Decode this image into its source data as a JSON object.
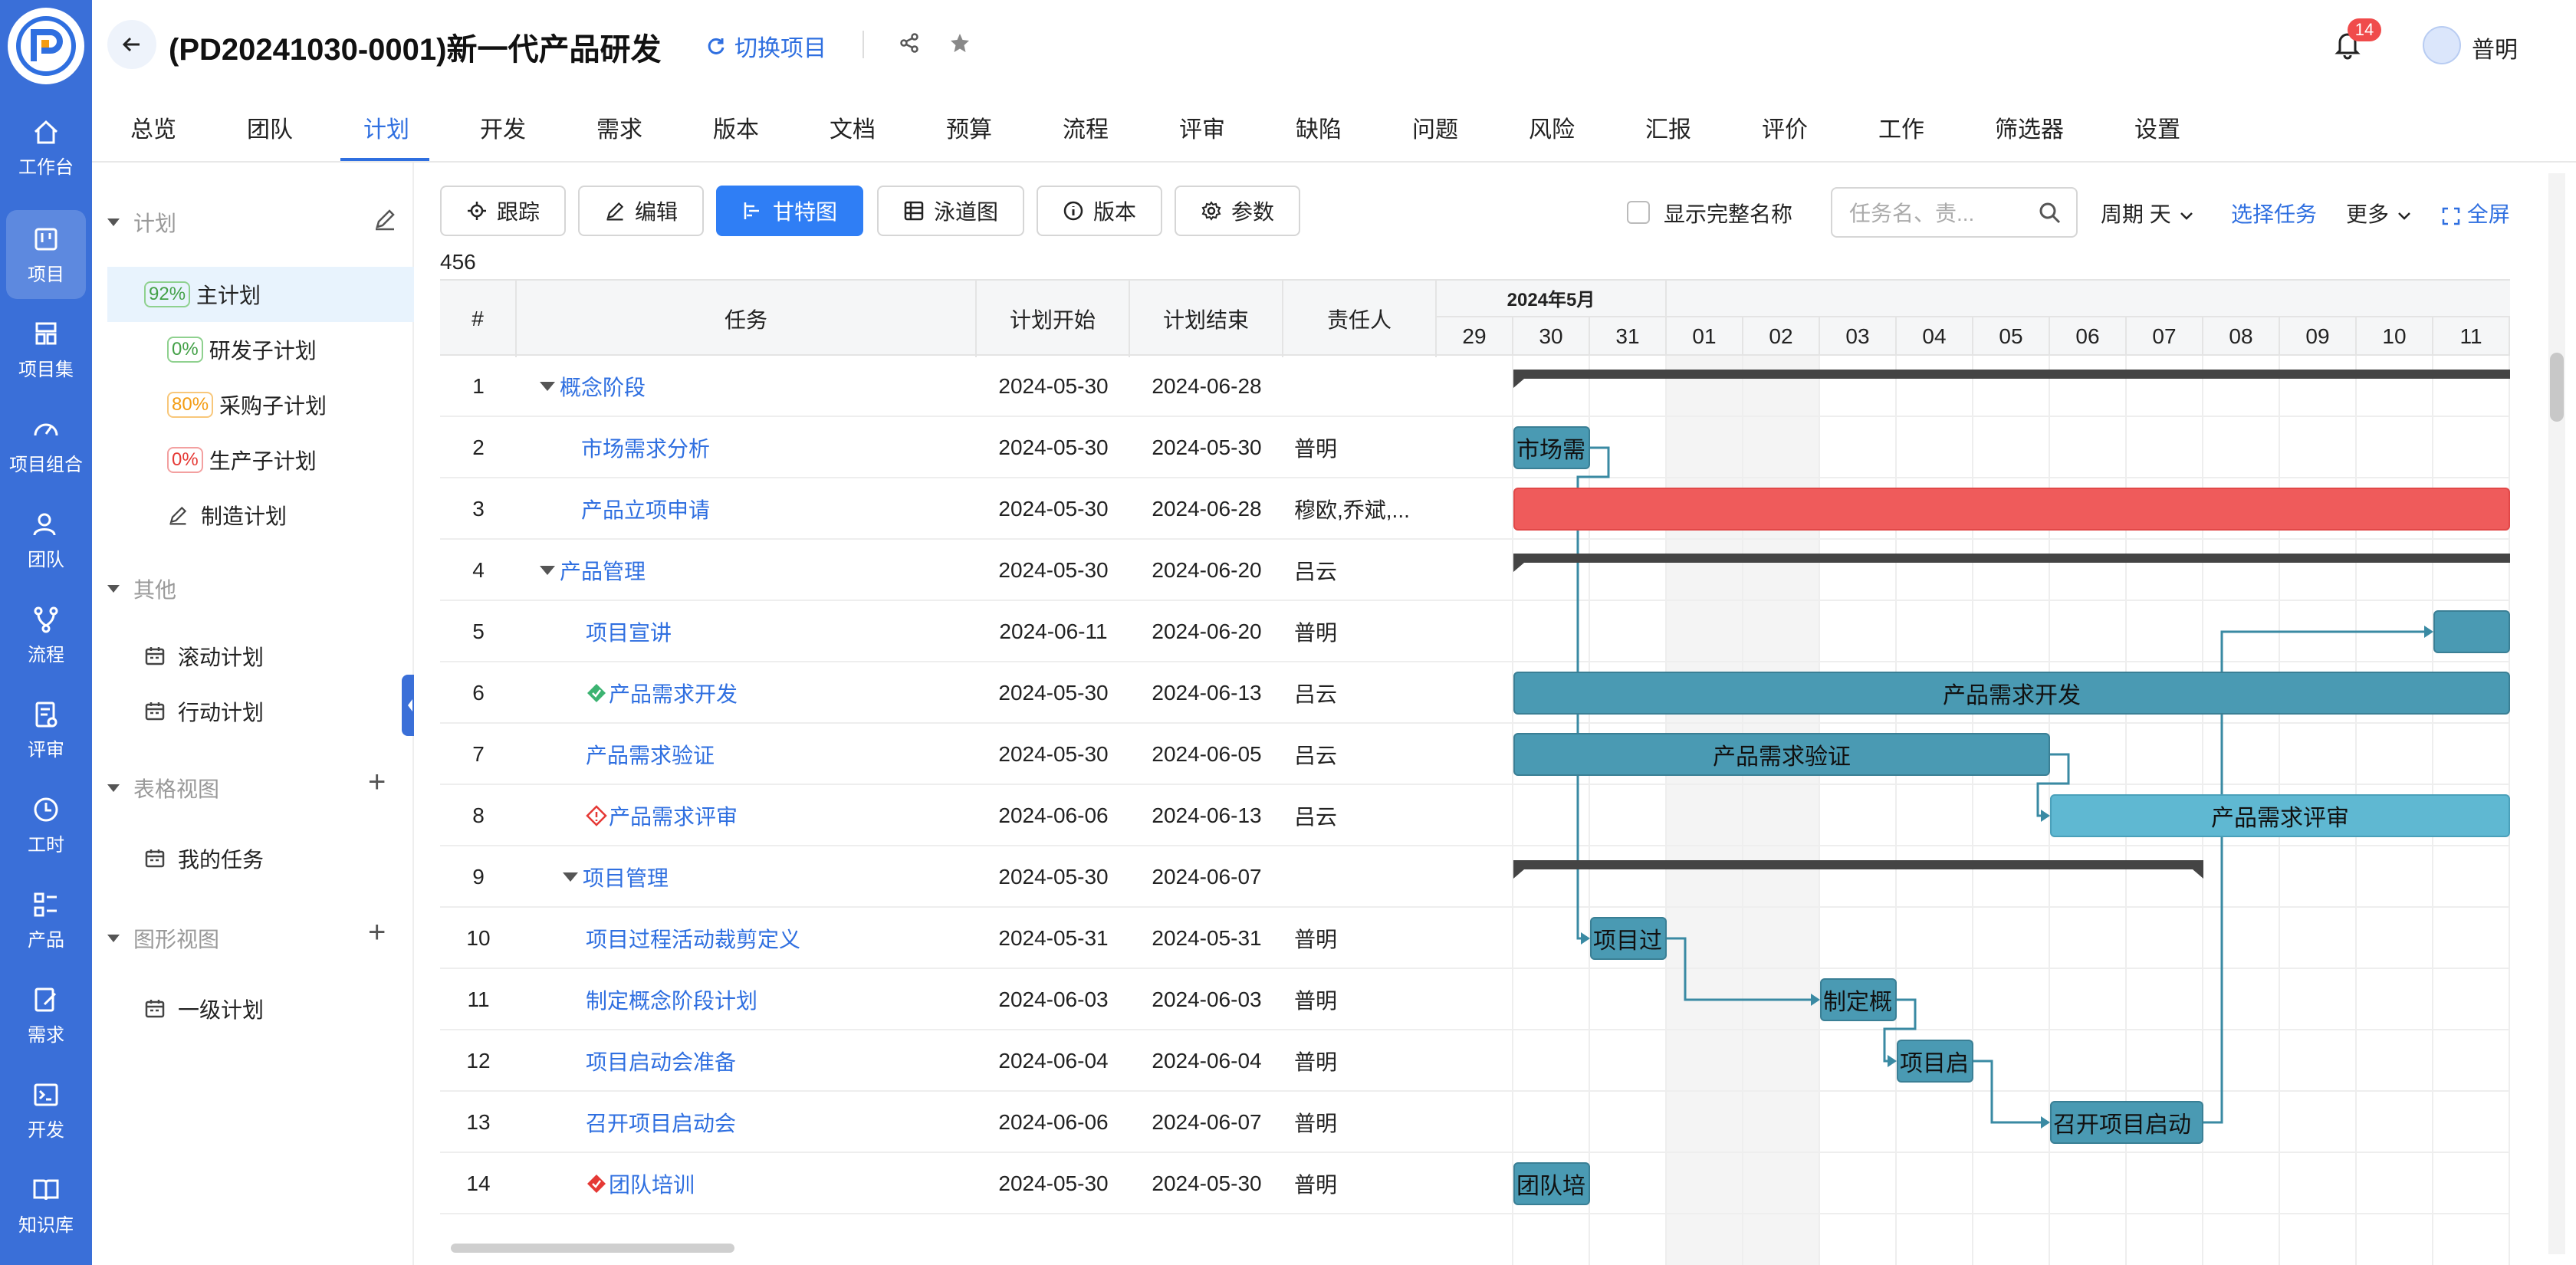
{
  "header": {
    "title": "(PD20241030-0001)新一代产品研发",
    "switch_label": "切换项目",
    "notifications": "14",
    "user": "普明"
  },
  "rail": {
    "items": [
      {
        "label": "工作台",
        "icon": "home-icon"
      },
      {
        "label": "项目",
        "icon": "board-icon"
      },
      {
        "label": "项目集",
        "icon": "stack-icon"
      },
      {
        "label": "项目组合",
        "icon": "dashboard-icon"
      },
      {
        "label": "团队",
        "icon": "team-icon"
      },
      {
        "label": "流程",
        "icon": "flow-icon"
      },
      {
        "label": "评审",
        "icon": "review-icon"
      },
      {
        "label": "工时",
        "icon": "clock-icon"
      },
      {
        "label": "产品",
        "icon": "product-icon"
      },
      {
        "label": "需求",
        "icon": "edit-doc-icon"
      },
      {
        "label": "开发",
        "icon": "terminal-icon"
      },
      {
        "label": "知识库",
        "icon": "book-icon"
      }
    ]
  },
  "tabs": [
    "总览",
    "团队",
    "计划",
    "开发",
    "需求",
    "版本",
    "文档",
    "预算",
    "流程",
    "评审",
    "缺陷",
    "问题",
    "风险",
    "汇报",
    "评价",
    "工作",
    "筛选器",
    "设置"
  ],
  "tree": {
    "group_plan": "计划",
    "plans": [
      {
        "pct": "92%",
        "label": "主计划"
      },
      {
        "pct": "0%",
        "label": "研发子计划"
      },
      {
        "pct": "80%",
        "label": "采购子计划"
      },
      {
        "pct": "0%",
        "label": "生产子计划"
      },
      {
        "pct": "",
        "label": "制造计划"
      }
    ],
    "group_other": "其他",
    "others": [
      "滚动计划",
      "行动计划"
    ],
    "group_table": "表格视图",
    "table_views": [
      "我的任务"
    ],
    "group_graph": "图形视图",
    "graph_views": [
      "一级计划"
    ]
  },
  "toolbar": {
    "track": "跟踪",
    "edit": "编辑",
    "gantt": "甘特图",
    "swimlane": "泳道图",
    "version": "版本",
    "params": "参数",
    "show_full_name": "显示完整名称",
    "search_placeholder": "任务名、责...",
    "period": "周期 天",
    "select_task": "选择任务",
    "more": "更多",
    "fullscreen": "全屏"
  },
  "count": "456",
  "table": {
    "headers": [
      "#",
      "任务",
      "计划开始",
      "计划结束",
      "责任人"
    ],
    "rows": [
      {
        "n": "1",
        "task": "概念阶段",
        "start": "2024-05-30",
        "end": "2024-06-28",
        "owner": ""
      },
      {
        "n": "2",
        "task": "市场需求分析",
        "start": "2024-05-30",
        "end": "2024-05-30",
        "owner": "普明"
      },
      {
        "n": "3",
        "task": "产品立项申请",
        "start": "2024-05-30",
        "end": "2024-06-28",
        "owner": "穆欧,乔斌,..."
      },
      {
        "n": "4",
        "task": "产品管理",
        "start": "2024-05-30",
        "end": "2024-06-20",
        "owner": "吕云"
      },
      {
        "n": "5",
        "task": "项目宣讲",
        "start": "2024-06-11",
        "end": "2024-06-20",
        "owner": "普明"
      },
      {
        "n": "6",
        "task": "产品需求开发",
        "start": "2024-05-30",
        "end": "2024-06-13",
        "owner": "吕云"
      },
      {
        "n": "7",
        "task": "产品需求验证",
        "start": "2024-05-30",
        "end": "2024-06-05",
        "owner": "吕云"
      },
      {
        "n": "8",
        "task": "产品需求评审",
        "start": "2024-06-06",
        "end": "2024-06-13",
        "owner": "吕云"
      },
      {
        "n": "9",
        "task": "项目管理",
        "start": "2024-05-30",
        "end": "2024-06-07",
        "owner": ""
      },
      {
        "n": "10",
        "task": "项目过程活动裁剪定义",
        "start": "2024-05-31",
        "end": "2024-05-31",
        "owner": "普明"
      },
      {
        "n": "11",
        "task": "制定概念阶段计划",
        "start": "2024-06-03",
        "end": "2024-06-03",
        "owner": "普明"
      },
      {
        "n": "12",
        "task": "项目启动会准备",
        "start": "2024-06-04",
        "end": "2024-06-04",
        "owner": "普明"
      },
      {
        "n": "13",
        "task": "召开项目启动会",
        "start": "2024-06-06",
        "end": "2024-06-07",
        "owner": "普明"
      },
      {
        "n": "14",
        "task": "团队培训",
        "start": "2024-05-30",
        "end": "2024-05-30",
        "owner": "普明"
      }
    ]
  },
  "gantt": {
    "month": "2024年5月",
    "days": [
      "29",
      "30",
      "31",
      "01",
      "02",
      "03",
      "04",
      "05",
      "06",
      "07",
      "08",
      "09",
      "10",
      "11"
    ],
    "bar_labels": {
      "r2": "市场需",
      "r6": "产品需求开发",
      "r7": "产品需求验证",
      "r8": "产品需求评审",
      "r10": "项目过",
      "r11": "制定概",
      "r12": "项目启",
      "r13": "召开项目启动",
      "r14": "团队培"
    },
    "colors": {
      "bar": "#4a9ab3",
      "bar_light": "#5fb8d2",
      "bar_red": "#ef5b5b",
      "summary": "#444444",
      "link": "#3a8aa3"
    }
  }
}
